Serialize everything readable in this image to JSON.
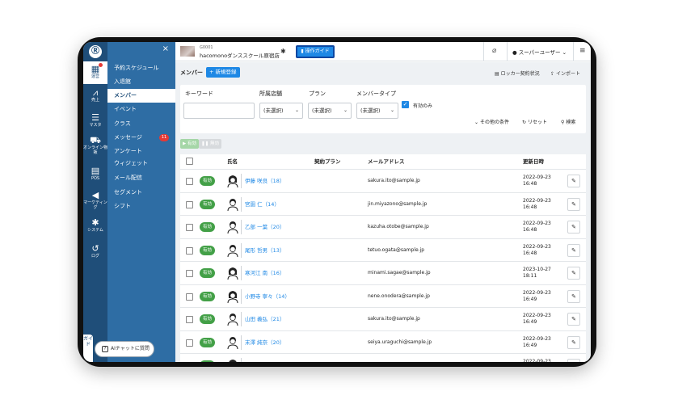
{
  "rail": {
    "logo": "Ⓡ",
    "items": [
      {
        "label": "運営",
        "icon": "calendar-icon"
      },
      {
        "label": "売上",
        "icon": "chart-icon"
      },
      {
        "label": "マスタ",
        "icon": "database-icon"
      },
      {
        "label": "オンライン物販",
        "icon": "cart-icon"
      },
      {
        "label": "POS",
        "icon": "register-icon"
      },
      {
        "label": "マーケティング",
        "icon": "megaphone-icon"
      },
      {
        "label": "システム",
        "icon": "gear-icon"
      },
      {
        "label": "ログ",
        "icon": "history-icon"
      }
    ],
    "guide_tab": "ガイド"
  },
  "submenu": {
    "close": "×",
    "items": [
      {
        "label": "予約スケジュール"
      },
      {
        "label": "入退館"
      },
      {
        "label": "メンバー",
        "active": true
      },
      {
        "label": "イベント"
      },
      {
        "label": "クラス"
      },
      {
        "label": "メッセージ",
        "badge": "11"
      },
      {
        "label": "アンケート"
      },
      {
        "label": "ウィジェット"
      },
      {
        "label": "メール配信"
      },
      {
        "label": "セグメント"
      },
      {
        "label": "シフト"
      }
    ],
    "ai_chat": "AIチャットに質問"
  },
  "topbar": {
    "shop_code": "G0001",
    "shop_name": "hacomonoダンススクール原宿店",
    "guide_button": "操作ガイド",
    "user_menu": "スーパーユーザー"
  },
  "page": {
    "title": "メンバー",
    "new_button": "+ 新規登録",
    "locker_link": "ロッカー契約状況",
    "import_link": "インポート"
  },
  "filter": {
    "keyword_label": "キーワード",
    "keyword_value": "",
    "store_label": "所属店舗",
    "store_value": "(未選択)",
    "plan_label": "プラン",
    "plan_value": "(未選択)",
    "type_label": "メンバータイプ",
    "type_value": "(未選択)",
    "active_only_label": "有効のみ",
    "other_conditions": "その他の条件",
    "reset": "リセット",
    "search": "検索"
  },
  "bulk": {
    "activate": "▶ 有効",
    "deactivate": "❚❚ 無効"
  },
  "table": {
    "headers": {
      "name": "氏名",
      "plan": "契約プラン",
      "email": "メールアドレス",
      "updated": "更新日時"
    },
    "rows": [
      {
        "status": "有効",
        "name": "伊藤 咲良（18）",
        "email": "sakura.ito@sample.jp",
        "date": "2022-09-23",
        "time": "16:48",
        "avatar": "female"
      },
      {
        "status": "有効",
        "name": "宮園 仁（14）",
        "email": "jin.miyazono@sample.jp",
        "date": "2022-09-23",
        "time": "16:48",
        "avatar": "male"
      },
      {
        "status": "有効",
        "name": "乙部 一葉（20）",
        "email": "kazuha.otobe@sample.jp",
        "date": "2022-09-23",
        "time": "16:48",
        "avatar": "male"
      },
      {
        "status": "有効",
        "name": "尾形 哲男（13）",
        "email": "tetuo.ogata@sample.jp",
        "date": "2022-09-23",
        "time": "16:48",
        "avatar": "male"
      },
      {
        "status": "有効",
        "name": "寒河江 南（16）",
        "email": "minami.sagae@sample.jp",
        "date": "2023-10-27",
        "time": "18:11",
        "avatar": "female"
      },
      {
        "status": "有効",
        "name": "小野寺 寧々（14）",
        "email": "nene.onodera@sample.jp",
        "date": "2022-09-23",
        "time": "16:49",
        "avatar": "female"
      },
      {
        "status": "有効",
        "name": "山田 義弘（21）",
        "email": "sakura.ito@sample.jp",
        "date": "2022-09-23",
        "time": "16:49",
        "avatar": "male"
      },
      {
        "status": "有効",
        "name": "末澤 純奈（20）",
        "email": "seiya.uraguchi@sample.jp",
        "date": "2022-09-23",
        "time": "16:49",
        "avatar": "male"
      },
      {
        "status": "有効",
        "name": "",
        "email": "",
        "date": "2022-09-23",
        "time": "",
        "avatar": "female"
      }
    ]
  }
}
